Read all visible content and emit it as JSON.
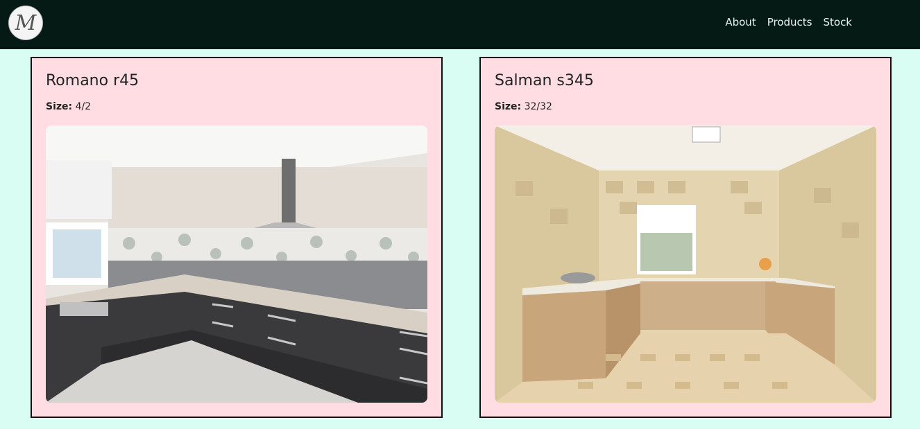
{
  "nav": {
    "logo_letter": "M",
    "links": [
      "About",
      "Products",
      "Stock"
    ]
  },
  "products": [
    {
      "name": "Romano r45",
      "size_label": "Size:",
      "size_value": "4/2",
      "image_icon": "kitchen-photo-icon"
    },
    {
      "name": "Salman s345",
      "size_label": "Size:",
      "size_value": "32/32",
      "image_icon": "kitchen-photo-icon"
    }
  ],
  "colors": {
    "page_bg": "#d9fdf3",
    "navbar_bg": "#051a15",
    "card_bg": "#ffdde3",
    "card_border": "#111111"
  }
}
